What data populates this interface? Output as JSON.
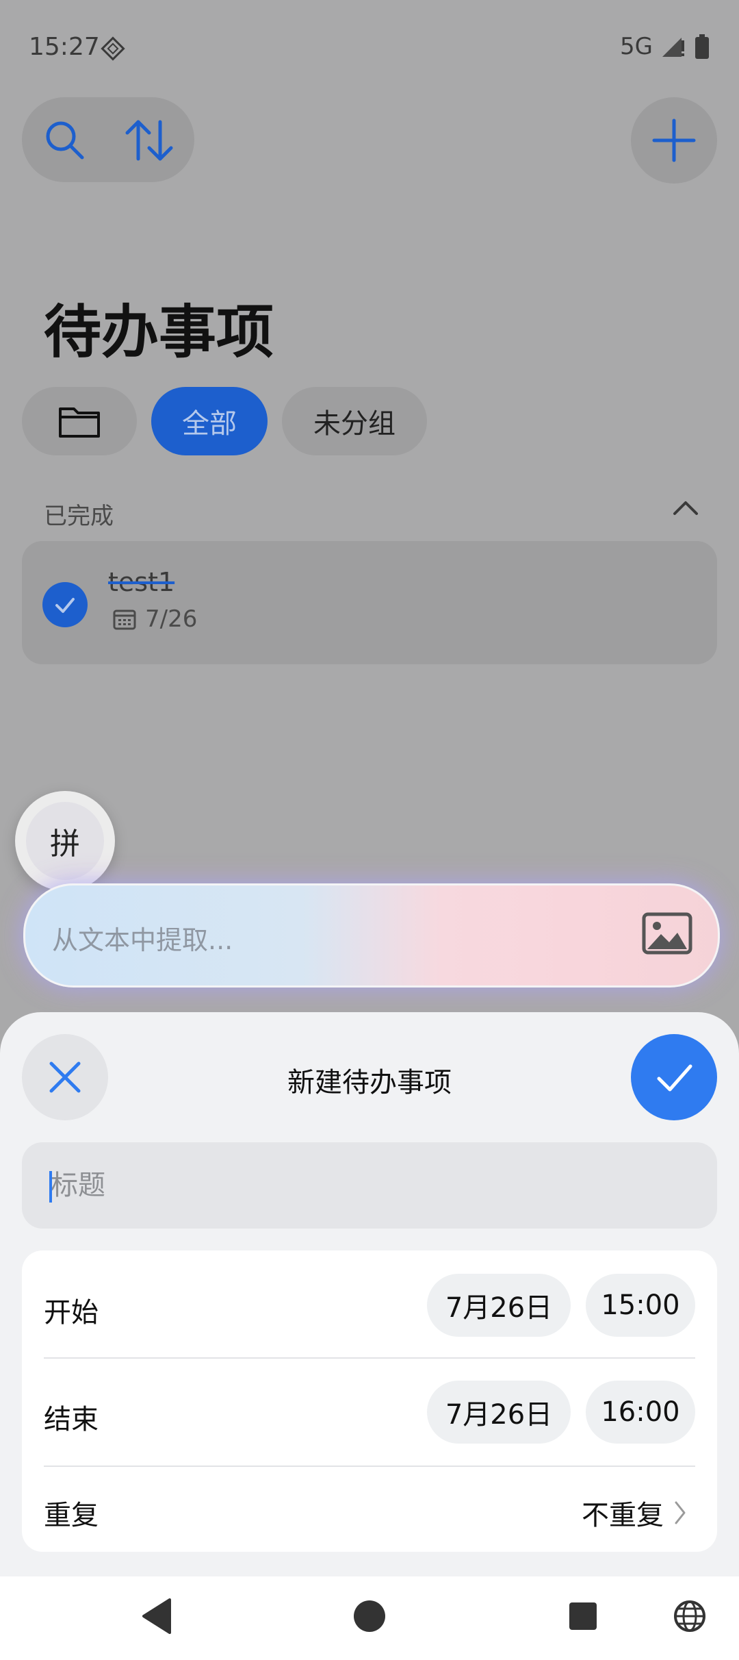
{
  "status_bar": {
    "time": "15:27",
    "network": "5G",
    "icons": [
      "diamond-notification-icon",
      "signal-icon",
      "battery-icon"
    ]
  },
  "toolbar": {
    "icons": [
      "search-icon",
      "sort-icon",
      "plus-icon"
    ]
  },
  "page": {
    "title": "待办事项"
  },
  "filters": {
    "all_label": "全部",
    "ungrouped_label": "未分组",
    "folder_icon": "folder-icon"
  },
  "completed_section": {
    "label": "已完成",
    "tasks": [
      {
        "title": "test1",
        "date": "7/26"
      }
    ]
  },
  "ime": {
    "label": "拼"
  },
  "extract": {
    "placeholder": "从文本中提取..."
  },
  "sheet": {
    "title": "新建待办事项",
    "title_placeholder": "标题",
    "start": {
      "label": "开始",
      "date": "7月26日",
      "time": "15:00"
    },
    "end": {
      "label": "结束",
      "date": "7月26日",
      "time": "16:00"
    },
    "repeat": {
      "label": "重复",
      "value": "不重复"
    }
  },
  "colors": {
    "accent": "#2f7bf0",
    "accent_dark": "#1d5fcd"
  }
}
